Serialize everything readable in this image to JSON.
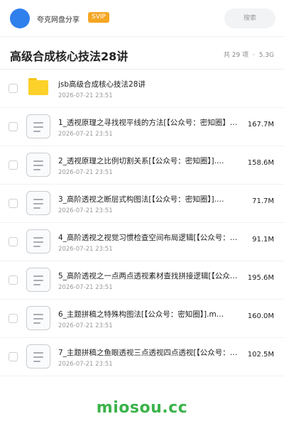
{
  "header": {
    "username": "夸克网盘分享",
    "badge": "SVIP",
    "search_placeholder": "搜索"
  },
  "folder": {
    "title": "高级合成核心技法28讲",
    "count": "共 29 项",
    "size_sep": "·",
    "total_size": "5.3G"
  },
  "items": [
    {
      "type": "folder",
      "icon": "folder-icon",
      "name": "jsb高级合成核心技法28讲",
      "date": "2026-07-21 23:51",
      "size": ""
    },
    {
      "type": "file",
      "icon": "document-icon",
      "name": "1_透视原理之寻找视平线的方法[【公众号：密知圈】…",
      "date": "2026-07-21 23:51",
      "size": "167.7M"
    },
    {
      "type": "file",
      "icon": "document-icon",
      "name": "2_透视原理之比例切割关系[【公众号：密知圈】].…",
      "date": "2026-07-21 23:51",
      "size": "158.6M"
    },
    {
      "type": "file",
      "icon": "document-icon",
      "name": "3_高阶透视之断层式构图法[【公众号：密知圈】].…",
      "date": "2026-07-21 23:51",
      "size": "71.7M"
    },
    {
      "type": "file",
      "icon": "document-icon",
      "name": "4_高阶透视之视觉习惯检查空间布局逻辑[【公众号：…",
      "date": "2026-07-21 23:51",
      "size": "91.1M"
    },
    {
      "type": "file",
      "icon": "document-icon",
      "name": "5_高阶透视之一点两点透视素材查找拼接逻辑[【公众…",
      "date": "2026-07-21 23:51",
      "size": "195.6M"
    },
    {
      "type": "file",
      "icon": "document-icon",
      "name": "6_主题拼稿之特殊构图法[【公众号：密知圈】].m…",
      "date": "2026-07-21 23:51",
      "size": "160.0M"
    },
    {
      "type": "file",
      "icon": "document-icon",
      "name": "7_主题拼稿之鱼眼透视三点透视四点透视[【公众号：…",
      "date": "2026-07-21 23:51",
      "size": "102.5M"
    }
  ],
  "watermark": "miosou.cc",
  "colors": {
    "accent": "#2f80ed",
    "badge": "#f5a623",
    "folder": "#fcd12a",
    "watermark": "#3bb34a"
  }
}
